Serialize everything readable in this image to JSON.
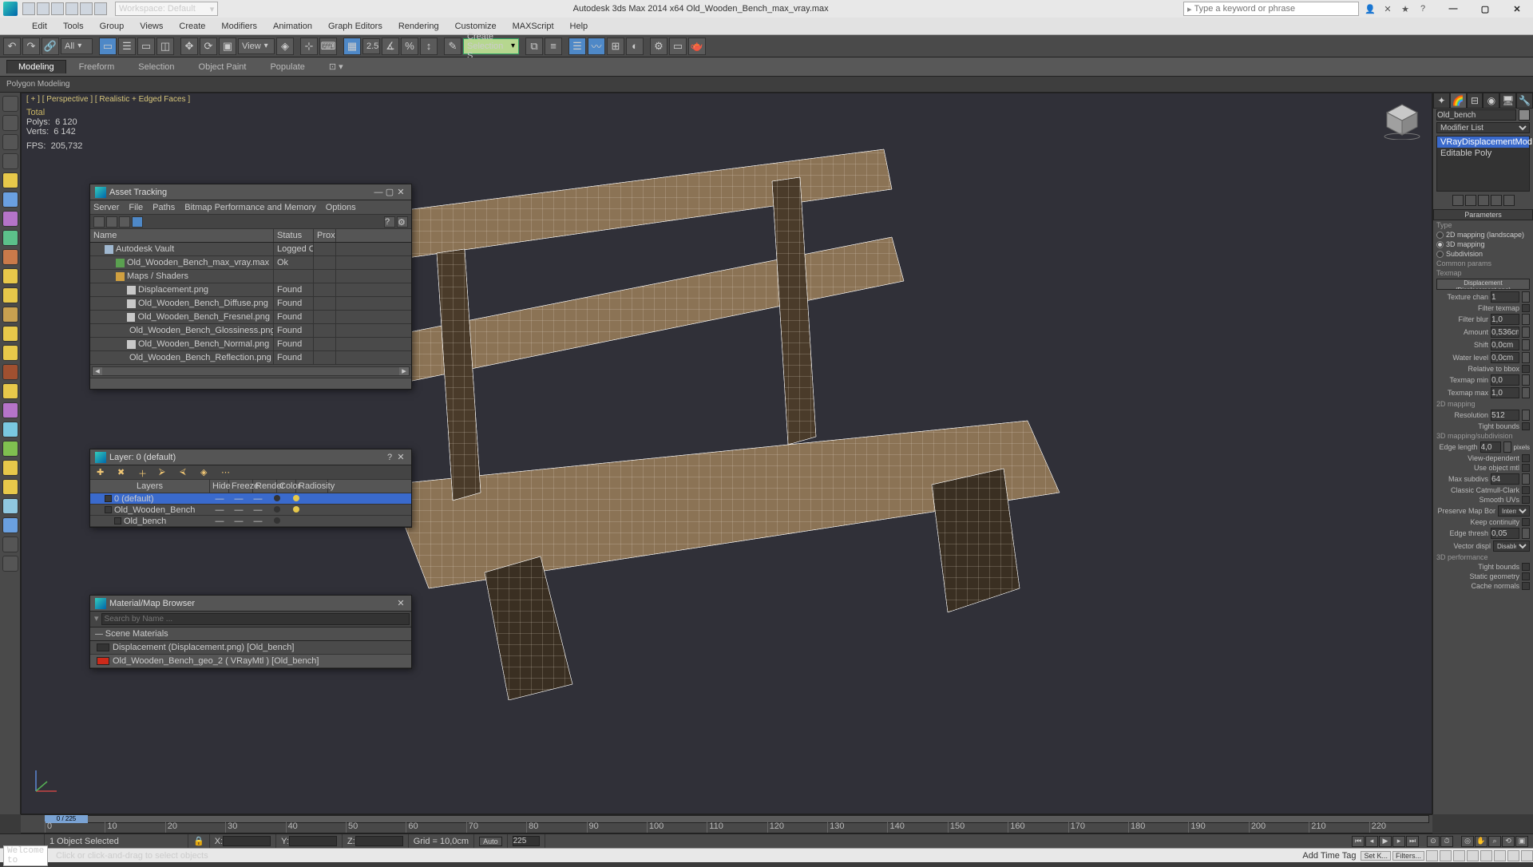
{
  "app": {
    "title_center": "Autodesk 3ds Max  2014 x64   Old_Wooden_Bench_max_vray.max",
    "workspace_label": "Workspace: Default",
    "search_placeholder": "Type a keyword or phrase"
  },
  "menu": [
    "Edit",
    "Tools",
    "Group",
    "Views",
    "Create",
    "Modifiers",
    "Animation",
    "Graph Editors",
    "Rendering",
    "Customize",
    "MAXScript",
    "Help"
  ],
  "main_toolbar": {
    "sel_filter": "All",
    "view_dd": "View",
    "spin_val": "2.5",
    "named_sel": "Create Selection S"
  },
  "ribbon_tabs": [
    "Modeling",
    "Freeform",
    "Selection",
    "Object Paint",
    "Populate"
  ],
  "ribbon_sub": "Polygon Modeling",
  "viewport": {
    "label": "[ + ] [ Perspective ] [ Realistic + Edged Faces ]",
    "stats_total": "Total",
    "polys_label": "Polys:",
    "polys_val": "6 120",
    "verts_label": "Verts:",
    "verts_val": "6 142",
    "fps_label": "FPS:",
    "fps_val": "205,732"
  },
  "asset_tracking": {
    "title": "Asset Tracking",
    "menu": [
      "Server",
      "File",
      "Paths",
      "Bitmap Performance and Memory",
      "Options"
    ],
    "col_name": "Name",
    "col_status": "Status",
    "col_proxy": "Prox",
    "rows": [
      {
        "indent": 1,
        "icon": "vault",
        "name": "Autodesk Vault",
        "status": "Logged O…",
        "proxy": ""
      },
      {
        "indent": 2,
        "icon": "max",
        "name": "Old_Wooden_Bench_max_vray.max",
        "status": "Ok",
        "proxy": ""
      },
      {
        "indent": 2,
        "icon": "folder",
        "name": "Maps / Shaders",
        "status": "",
        "proxy": ""
      },
      {
        "indent": 3,
        "icon": "img",
        "name": "Displacement.png",
        "status": "Found",
        "proxy": ""
      },
      {
        "indent": 3,
        "icon": "img",
        "name": "Old_Wooden_Bench_Diffuse.png",
        "status": "Found",
        "proxy": ""
      },
      {
        "indent": 3,
        "icon": "img",
        "name": "Old_Wooden_Bench_Fresnel.png",
        "status": "Found",
        "proxy": ""
      },
      {
        "indent": 3,
        "icon": "img",
        "name": "Old_Wooden_Bench_Glossiness.png",
        "status": "Found",
        "proxy": ""
      },
      {
        "indent": 3,
        "icon": "img",
        "name": "Old_Wooden_Bench_Normal.png",
        "status": "Found",
        "proxy": ""
      },
      {
        "indent": 3,
        "icon": "img",
        "name": "Old_Wooden_Bench_Reflection.png",
        "status": "Found",
        "proxy": ""
      }
    ]
  },
  "layer_panel": {
    "title": "Layer: 0 (default)",
    "cols": [
      "Layers",
      "Hide",
      "Freeze",
      "Render",
      "Color",
      "Radiosity"
    ],
    "rows": [
      {
        "name": "0 (default)",
        "sel": true,
        "indent": 1,
        "color": "#333",
        "rad": "#e7c84a"
      },
      {
        "name": "Old_Wooden_Bench",
        "sel": false,
        "indent": 1,
        "color": "#333",
        "rad": "#e7c84a"
      },
      {
        "name": "Old_bench",
        "sel": false,
        "indent": 2,
        "color": "#333",
        "rad": ""
      }
    ]
  },
  "mat_browser": {
    "title": "Material/Map Browser",
    "search_ph": "Search by Name ...",
    "group": "Scene Materials",
    "items": [
      {
        "label": "Displacement (Displacement.png) [Old_bench]",
        "swatch": "#333",
        "sel": false
      },
      {
        "label": "Old_Wooden_Bench_geo_2  ( VRayMtl ) [Old_bench]",
        "swatch": "#cc2a1a",
        "sel": true
      }
    ]
  },
  "command_panel": {
    "obj_name": "Old_bench",
    "mod_list_label": "Modifier List",
    "stack": [
      "VRayDisplacementMod",
      "Editable Poly"
    ],
    "rollout_params": "Parameters",
    "type_label": "Type",
    "type_opts": [
      "2D mapping (landscape)",
      "3D mapping",
      "Subdivision"
    ],
    "type_sel": 1,
    "common_params": "Common params",
    "texmap_label": "Texmap",
    "texmap_btn": "Displacement (Displacement.png)",
    "texture_chan": "Texture chan",
    "texture_chan_val": "1",
    "filter_texmap": "Filter texmap",
    "filter_blur": "Filter blur",
    "filter_blur_val": "1,0",
    "amount": "Amount",
    "amount_val": "0,536cm",
    "shift": "Shift",
    "shift_val": "0,0cm",
    "water_level": "Water level",
    "water_level_val": "0,0cm",
    "rel_bbox": "Relative to bbox",
    "texmap_min": "Texmap min",
    "texmap_min_val": "0,0",
    "texmap_max": "Texmap max",
    "texmap_max_val": "1,0",
    "sec_2d": "2D mapping",
    "resolution": "Resolution",
    "resolution_val": "512",
    "tight_bounds": "Tight bounds",
    "sec_3d": "3D mapping/subdivision",
    "edge_length": "Edge length",
    "edge_length_val": "4,0",
    "edge_length_unit": "pixels",
    "view_dep": "View-dependent",
    "use_obj_mtl": "Use object mtl",
    "max_subdivs": "Max subdivs",
    "max_subdivs_val": "64",
    "catmull": "Classic Catmull-Clark",
    "smooth_uvs": "Smooth UVs",
    "preserve_map": "Preserve Map Bor",
    "preserve_map_val": "Internal",
    "keep_cont": "Keep continuity",
    "edge_thresh": "Edge thresh",
    "edge_thresh_val": "0,05",
    "vector_displ": "Vector displ",
    "vector_displ_val": "Disabled",
    "sec_perf": "3D performance",
    "tight_bounds2": "Tight bounds",
    "static_geom": "Static geometry",
    "cache_normals": "Cache normals"
  },
  "timeline": {
    "cursor": "0 / 225"
  },
  "status": {
    "selected": "1 Object Selected",
    "x": "X:",
    "y": "Y:",
    "z": "Z:",
    "grid": "Grid = 10,0cm",
    "auto": "Auto",
    "frame": "225",
    "add_tag": "Add Time Tag",
    "set_key": "Set K...",
    "filters": "Filters..."
  },
  "statusB": {
    "welcome": "Welcome to",
    "hint": "Click or click-and-drag to select objects"
  }
}
